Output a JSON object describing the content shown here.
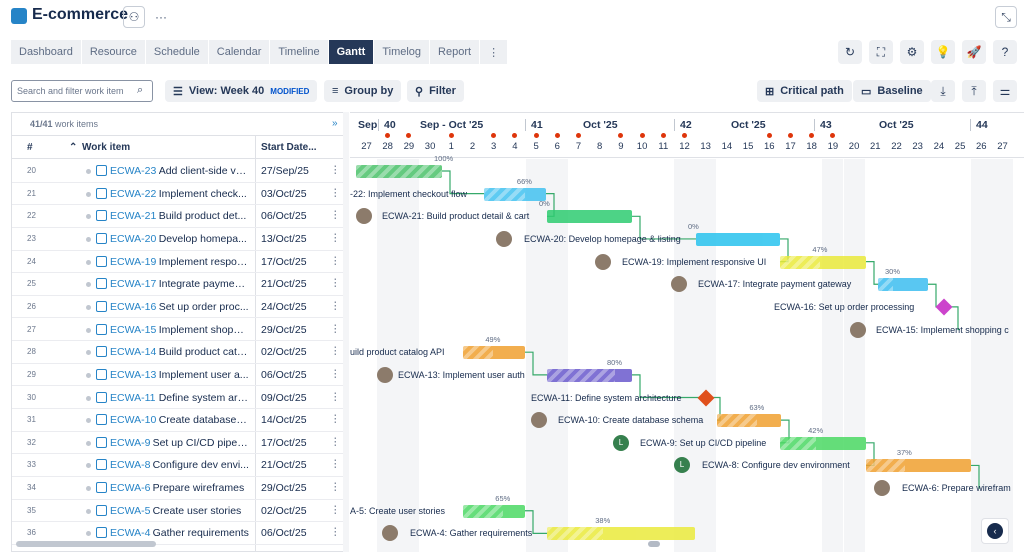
{
  "app": {
    "title": "E-commerce"
  },
  "tabs": [
    "Dashboard",
    "Resource",
    "Schedule",
    "Calendar",
    "Timeline",
    "Gantt",
    "Timelog",
    "Report"
  ],
  "toolbar": {
    "search_placeholder": "Search and filter work item",
    "view_label": "View: Week 40",
    "view_badge": "MODIFIED",
    "group_label": "Group by",
    "filter_label": "Filter",
    "critical_label": "Critical path",
    "baseline_label": "Baseline"
  },
  "grid": {
    "count": "41/41",
    "count_suffix": "work items",
    "col_num": "#",
    "col_item": "Work item",
    "col_start": "Start Date...",
    "rows": [
      {
        "n": "20",
        "key": "ECWA-23",
        "name": "Add client-side va...",
        "start": "27/Sep/25"
      },
      {
        "n": "21",
        "key": "ECWA-22",
        "name": "Implement check...",
        "start": "03/Oct/25"
      },
      {
        "n": "22",
        "key": "ECWA-21",
        "name": "Build product det...",
        "start": "06/Oct/25"
      },
      {
        "n": "23",
        "key": "ECWA-20",
        "name": "Develop homepa...",
        "start": "13/Oct/25"
      },
      {
        "n": "24",
        "key": "ECWA-19",
        "name": "Implement respon...",
        "start": "17/Oct/25"
      },
      {
        "n": "25",
        "key": "ECWA-17",
        "name": "Integrate payment...",
        "start": "21/Oct/25"
      },
      {
        "n": "26",
        "key": "ECWA-16",
        "name": "Set up order proc...",
        "start": "24/Oct/25"
      },
      {
        "n": "27",
        "key": "ECWA-15",
        "name": "Implement shoppi...",
        "start": "29/Oct/25"
      },
      {
        "n": "28",
        "key": "ECWA-14",
        "name": "Build product cata...",
        "start": "02/Oct/25"
      },
      {
        "n": "29",
        "key": "ECWA-13",
        "name": "Implement user a...",
        "start": "06/Oct/25"
      },
      {
        "n": "30",
        "key": "ECWA-11",
        "name": "Define system arc...",
        "start": "09/Oct/25"
      },
      {
        "n": "31",
        "key": "ECWA-10",
        "name": "Create database s...",
        "start": "14/Oct/25"
      },
      {
        "n": "32",
        "key": "ECWA-9",
        "name": "Set up CI/CD pipeli...",
        "start": "17/Oct/25"
      },
      {
        "n": "33",
        "key": "ECWA-8",
        "name": "Configure dev envi...",
        "start": "21/Oct/25"
      },
      {
        "n": "34",
        "key": "ECWA-6",
        "name": "Prepare wireframes",
        "start": "29/Oct/25"
      },
      {
        "n": "35",
        "key": "ECWA-5",
        "name": "Create user stories",
        "start": "02/Oct/25"
      },
      {
        "n": "36",
        "key": "ECWA-4",
        "name": "Gather requirements",
        "start": "06/Oct/25"
      }
    ]
  },
  "timeline": {
    "weeks": [
      {
        "label": "Sep"
      },
      {
        "label": "40"
      },
      {
        "label": "Sep - Oct '25"
      },
      {
        "label": "41"
      },
      {
        "label": "Oct '25"
      },
      {
        "label": "42"
      },
      {
        "label": "Oct '25"
      },
      {
        "label": "43"
      },
      {
        "label": "Oct '25"
      },
      {
        "label": "44"
      }
    ],
    "days": [
      "27",
      "28",
      "29",
      "30",
      "1",
      "2",
      "3",
      "4",
      "5",
      "6",
      "7",
      "8",
      "9",
      "10",
      "11",
      "12",
      "13",
      "14",
      "15",
      "16",
      "17",
      "18",
      "19",
      "20",
      "21",
      "22",
      "23",
      "24",
      "25",
      "26",
      "27"
    ]
  },
  "bars": [
    {
      "label": "",
      "pct": "100%"
    },
    {
      "label": "-22: Implement checkout flow",
      "pct": "66%"
    },
    {
      "label": "ECWA-21: Build product detail & cart",
      "pct": "0%"
    },
    {
      "label": "ECWA-20: Develop homepage & listing",
      "pct": "0%"
    },
    {
      "label": "ECWA-19: Implement responsive UI",
      "pct": "47%"
    },
    {
      "label": "ECWA-17: Integrate payment gateway",
      "pct": "30%"
    },
    {
      "label": "ECWA-16: Set up order processing",
      "pct": ""
    },
    {
      "label": "ECWA-15: Implement shopping c",
      "pct": ""
    },
    {
      "label": "uild product catalog API",
      "pct": "49%"
    },
    {
      "label": "ECWA-13: Implement user auth",
      "pct": "80%"
    },
    {
      "label": "ECWA-11: Define system architecture",
      "pct": ""
    },
    {
      "label": "ECWA-10: Create database schema",
      "pct": "63%"
    },
    {
      "label": "ECWA-9: Set up CI/CD pipeline",
      "pct": "42%"
    },
    {
      "label": "ECWA-8: Configure dev environment",
      "pct": "37%"
    },
    {
      "label": "ECWA-6: Prepare wirefram",
      "pct": ""
    },
    {
      "label": "A-5: Create user stories",
      "pct": "65%"
    },
    {
      "label": "ECWA-4: Gather requirements",
      "pct": "38%"
    }
  ],
  "avatars": {
    "L": "L"
  },
  "colors": {
    "accent": "#2684c7",
    "active_tab": "#253858",
    "milestone_pink": "#cc44cc",
    "milestone_red": "#e0501c"
  }
}
